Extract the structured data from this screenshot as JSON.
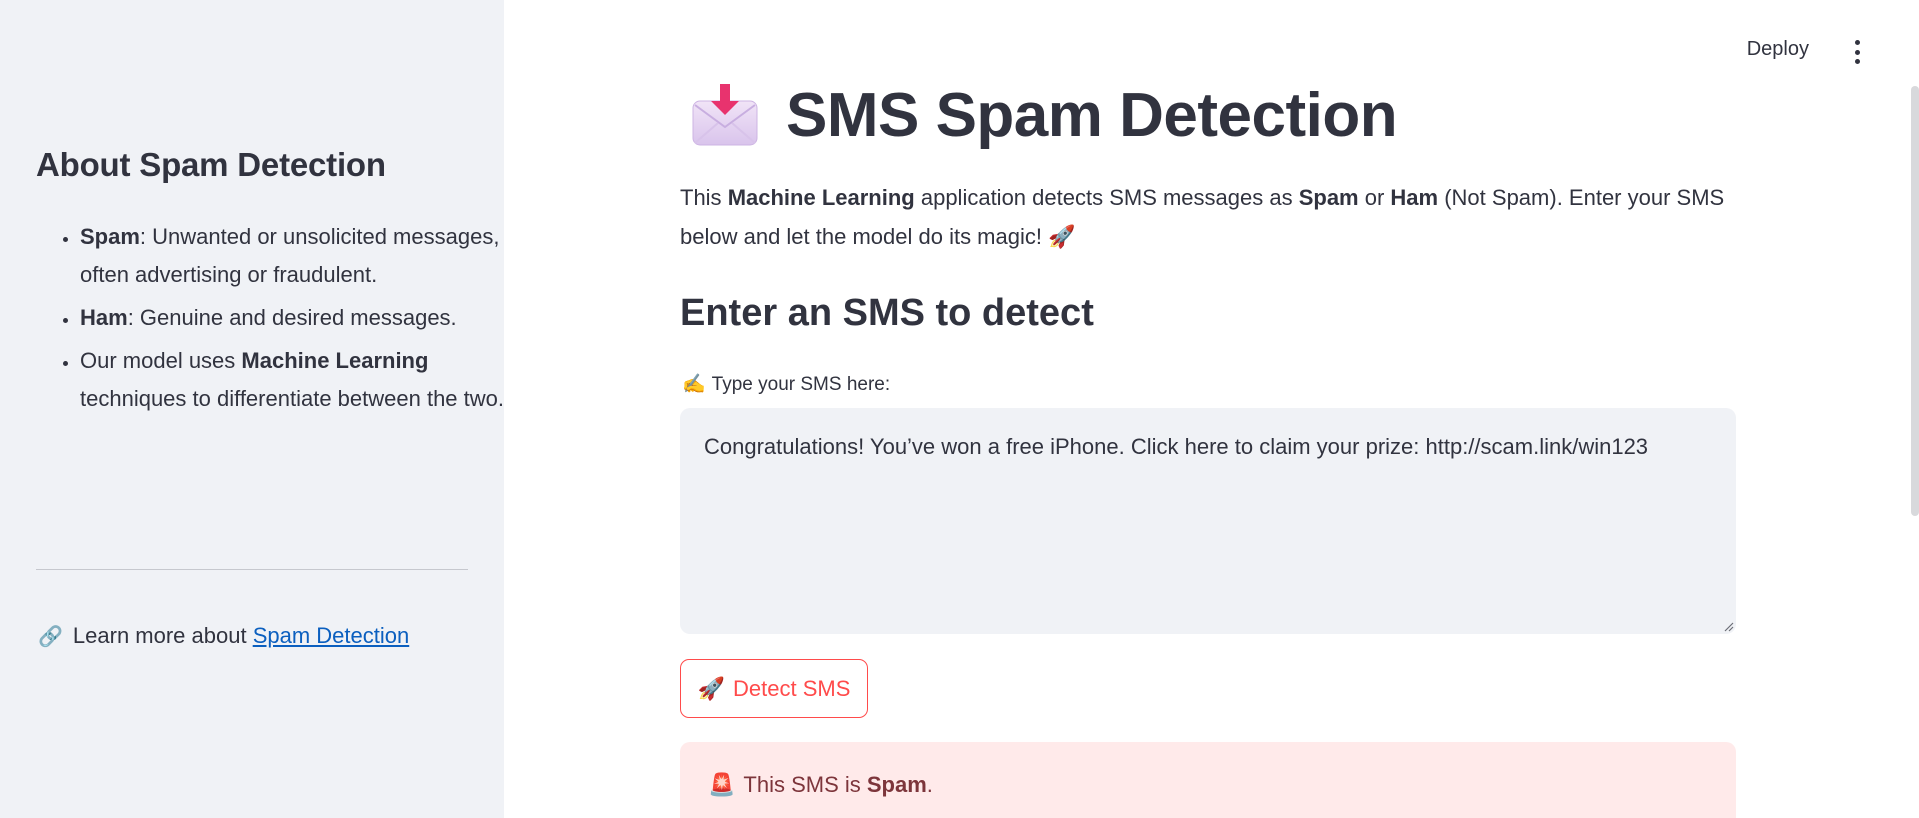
{
  "header": {
    "deploy_label": "Deploy"
  },
  "sidebar": {
    "title": "About Spam Detection",
    "items": [
      {
        "bold": "Spam",
        "text": ": Unwanted or unsolicited messages, often advertising or fraudulent."
      },
      {
        "bold": "Ham",
        "text": ": Genuine and desired messages."
      },
      {
        "prefix": "Our model uses ",
        "bold": "Machine Learning",
        "text": " techniques to differentiate between the two."
      }
    ],
    "learn_more": {
      "icon": "🔗",
      "prefix": "Learn more about ",
      "link_text": "Spam Detection"
    }
  },
  "main": {
    "title_icon": "📩",
    "title": "SMS Spam Detection",
    "intro": {
      "p1": "This ",
      "b1": "Machine Learning",
      "p2": " application detects SMS messages as ",
      "b2": "Spam",
      "p3": " or ",
      "b3": "Ham",
      "p4": " (Not Spam). Enter your SMS below and let the model do its magic! 🚀"
    },
    "section_title": "Enter an SMS to detect",
    "input_label_icon": "✍️",
    "input_label": "Type your SMS here:",
    "sms_value": "Congratulations! You’ve won a free iPhone. Click here to claim your prize: http://scam.link/win123",
    "detect_button": {
      "icon": "🚀",
      "label": "Detect SMS"
    },
    "result": {
      "icon": "🚨",
      "prefix": "This SMS is ",
      "bold": "Spam",
      "suffix": "."
    }
  },
  "colors": {
    "sidebar_bg": "#f0f2f6",
    "primary": "#ff4b4b",
    "error_bg": "#ffeaea",
    "error_text": "#7d353b",
    "link": "#0b5fbf",
    "text": "#31333f"
  }
}
